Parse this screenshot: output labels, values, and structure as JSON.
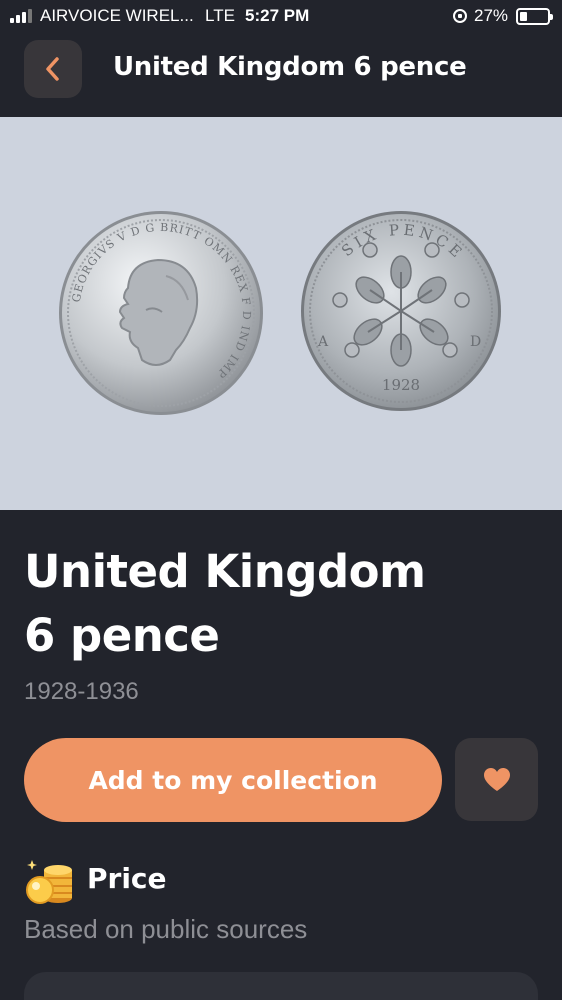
{
  "status_bar": {
    "carrier": "AIRVOICE WIREL...",
    "network": "LTE",
    "time": "5:27 PM",
    "battery": "27%"
  },
  "header": {
    "back_icon": "chevron-left-icon",
    "title": "United Kingdom 6 pence"
  },
  "coin": {
    "obverse_legend": "GEORGIVS V D G BRITT OMN REX F D IND IMP",
    "reverse_legend_top": "SIX PENCE",
    "reverse_letters": [
      "A",
      "D"
    ],
    "reverse_year": "1928"
  },
  "details": {
    "title_line1": "United Kingdom",
    "title_line2": "6 pence",
    "years": "1928-1936"
  },
  "actions": {
    "add_label": "Add to my collection",
    "favorite_icon": "heart-icon"
  },
  "price": {
    "icon": "coins-stack-icon",
    "title": "Price",
    "subtitle": "Based on public sources"
  },
  "colors": {
    "accent": "#ef9464",
    "background": "#22242c",
    "card": "#38363a",
    "image_bg": "#cdd3de"
  }
}
